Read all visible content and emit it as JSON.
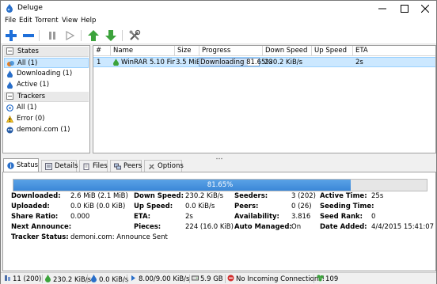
{
  "window": {
    "title": "Deluge"
  },
  "menu": [
    "File",
    "Edit",
    "Torrent",
    "View",
    "Help"
  ],
  "sidebar": {
    "states_label": "States",
    "states": [
      {
        "label": "All (1)",
        "icon": "all-states-icon"
      },
      {
        "label": "Downloading (1)",
        "icon": "downloading-icon"
      },
      {
        "label": "Active (1)",
        "icon": "active-icon"
      }
    ],
    "trackers_label": "Trackers",
    "trackers": [
      {
        "label": "All (1)",
        "icon": "all-trackers-icon"
      },
      {
        "label": "Error (0)",
        "icon": "error-icon"
      },
      {
        "label": "demoni.com (1)",
        "icon": "tracker-favicon-icon"
      }
    ]
  },
  "table": {
    "columns": [
      "#",
      "Name",
      "Size",
      "Progress",
      "Down Speed",
      "Up Speed",
      "ETA"
    ],
    "rows": [
      {
        "num": "1",
        "name": "WinRAR 5.10 Final",
        "size": "3.5 MiB",
        "progress_text": "Downloading 81.65%",
        "progress": 0.8165,
        "down": "230.2 KiB/s",
        "up": "",
        "eta": "2s"
      }
    ]
  },
  "tabs": [
    "Status",
    "Details",
    "Files",
    "Peers",
    "Options"
  ],
  "status": {
    "progress_text": "81.65%",
    "progress": 0.8165,
    "labels": {
      "downloaded": "Downloaded:",
      "uploaded": "Uploaded:",
      "share_ratio": "Share Ratio:",
      "next_announce": "Next Announce:",
      "tracker_status": "Tracker Status:",
      "down_speed": "Down Speed:",
      "up_speed": "Up Speed:",
      "eta": "ETA:",
      "pieces": "Pieces:",
      "seeders": "Seeders:",
      "peers": "Peers:",
      "availability": "Availability:",
      "auto_managed": "Auto Managed:",
      "active_time": "Active Time:",
      "seeding_time": "Seeding Time:",
      "seed_rank": "Seed Rank:",
      "date_added": "Date Added:"
    },
    "values": {
      "downloaded": "2.6 MiB (2.1 MiB)",
      "uploaded": "0.0 KiB (0.0 KiB)",
      "share_ratio": "0.000",
      "next_announce": "",
      "tracker_status": "demoni.com: Announce Sent",
      "down_speed": "230.2 KiB/s",
      "up_speed": "0.0 KiB/s",
      "eta": "2s",
      "pieces": "224 (16.0 KiB)",
      "seeders": "3 (202)",
      "peers": "0 (26)",
      "availability": "3.816",
      "auto_managed": "On",
      "active_time": "25s",
      "seeding_time": "",
      "seed_rank": "0",
      "date_added": "4/4/2015 15:41:07"
    }
  },
  "statusbar": {
    "connections": "11 (200)",
    "down": "230.2 KiB/s",
    "up": "0.0 KiB/s",
    "protocol": "8.00/9.00 KiB/s",
    "disk": "5.9 GB",
    "incoming": "No Incoming Connections!",
    "dht": "109"
  },
  "colors": {
    "selection": "#cce8ff",
    "progress": "#3b87d8",
    "toolbar_blue": "#1e6fd9",
    "toolbar_green": "#3ca33c"
  }
}
